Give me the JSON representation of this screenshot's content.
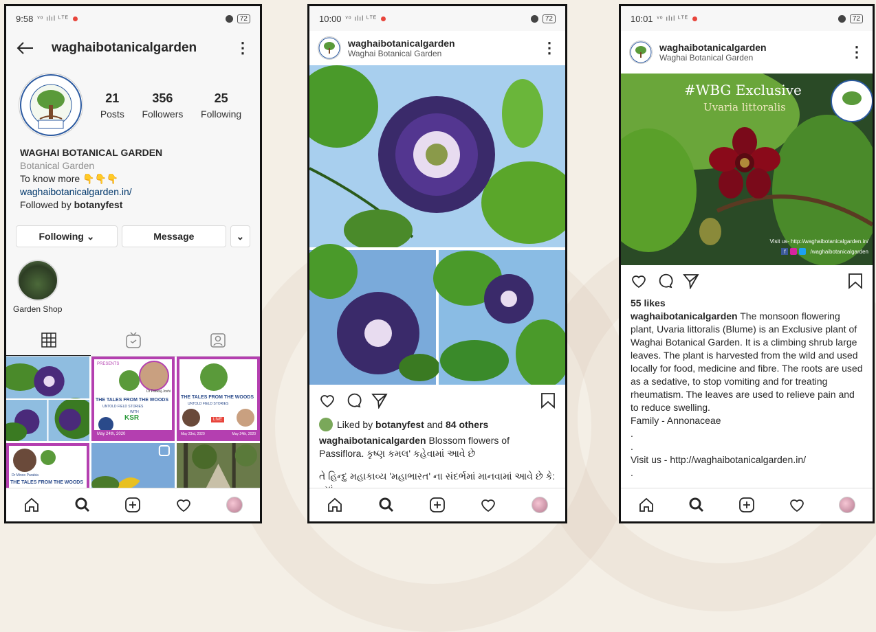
{
  "phone1": {
    "status": {
      "time": "9:58",
      "signal": "ᵛᵒ ılıl ᴸᵀᴱ",
      "battery": "72"
    },
    "username": "waghaibotanicalgarden",
    "stats": [
      {
        "num": "21",
        "label": "Posts"
      },
      {
        "num": "356",
        "label": "Followers"
      },
      {
        "num": "25",
        "label": "Following"
      }
    ],
    "bio": {
      "name": "WAGHAI BOTANICAL GARDEN",
      "category": "Botanical Garden",
      "line": "To know more 👇👇👇",
      "link": "waghaibotanicalgarden.in/",
      "followed_prefix": "Followed by ",
      "followed_by": "botanyfest"
    },
    "buttons": {
      "following": "Following ⌄",
      "message": "Message",
      "more": "⌄"
    },
    "highlight": "Garden Shop",
    "grid_texts": {
      "t1_title": "THE TALES FROM THE WOODS",
      "t1_sub": "UNTOLD FIELD STORIES",
      "t1_with": "WITH",
      "t1_ksr": "KSR",
      "t1_date": "May 24th, 2020",
      "speaker1": "Dr Pankaj Joshi",
      "presents": "PRESENTS",
      "t2_title": "THE TALES FROM THE WOODS",
      "t2_sub": "UNTOLD FIELD STORIES",
      "t2_date1": "May 23rd, 2020",
      "t2_date2": "May 24th, 2020",
      "t2_live": "LIVE",
      "t3_title": "THE TALES FROM THE WOODS",
      "t3_sub": "UNTOLD FIELD STORIES",
      "speaker2": "Dr Minoo Parabia"
    }
  },
  "phone2": {
    "status": {
      "time": "10:00",
      "signal": "ᵛᵒ ılıl ᴸᵀᴱ",
      "battery": "72"
    },
    "username": "waghaibotanicalgarden",
    "subtitle": "Waghai Botanical Garden",
    "liked_prefix": "Liked by ",
    "liked_user": "botanyfest",
    "liked_and": " and ",
    "liked_count": "84 others",
    "caption_user": "waghaibotanicalgarden",
    "caption_text": " Blossom flowers of Passiflora.  કૃષ્ણ કમલ' કહેવામાં આવે છે",
    "caption_line2": "તે હિન્દુ મહાકાવ્ય 'મહાભારત' ના સંદર્ભમાં માનવામાં આવે છે કે: ત્યાં"
  },
  "phone3": {
    "status": {
      "time": "10:01",
      "signal": "ᵛᵒ ılıl ᴸᵀᴱ",
      "battery": "72"
    },
    "username": "waghaibotanicalgarden",
    "subtitle": "Waghai Botanical Garden",
    "image_title": "#WBG Exclusive",
    "image_species": "Uvaria littoralis",
    "image_visit": "Visit us- http://waghaibotanicalgarden.in/",
    "image_handle": "/waghaibotanicalgarden",
    "likes": "55 likes",
    "caption_user": "waghaibotanicalgarden",
    "caption_text": " The monsoon flowering plant, Uvaria littoralis (Blume) is an Exclusive plant of Waghai Botanical Garden. It is a climbing shrub large leaves. The plant is harvested from the wild and used locally for food, medicine and fibre. The roots are used as a sedative, to stop vomiting and for treating rheumatism. The leaves are used to relieve pain and to reduce swelling.",
    "family": "Family - Annonaceae",
    "dot1": ".",
    "dot2": ".",
    "visit": "Visit us - http://waghaibotanicalgarden.in/",
    "dot3": ".",
    "dot4": "."
  },
  "logo_text": {
    "top": "Botanical Garden, South Dangs, Gujarat",
    "estd": "Estd. 1966"
  },
  "colors": {
    "accent_link": "#00376b",
    "divider": "#dbdbdb",
    "grid_purple": "#b43fb0",
    "brand_red": "#e8453c"
  }
}
